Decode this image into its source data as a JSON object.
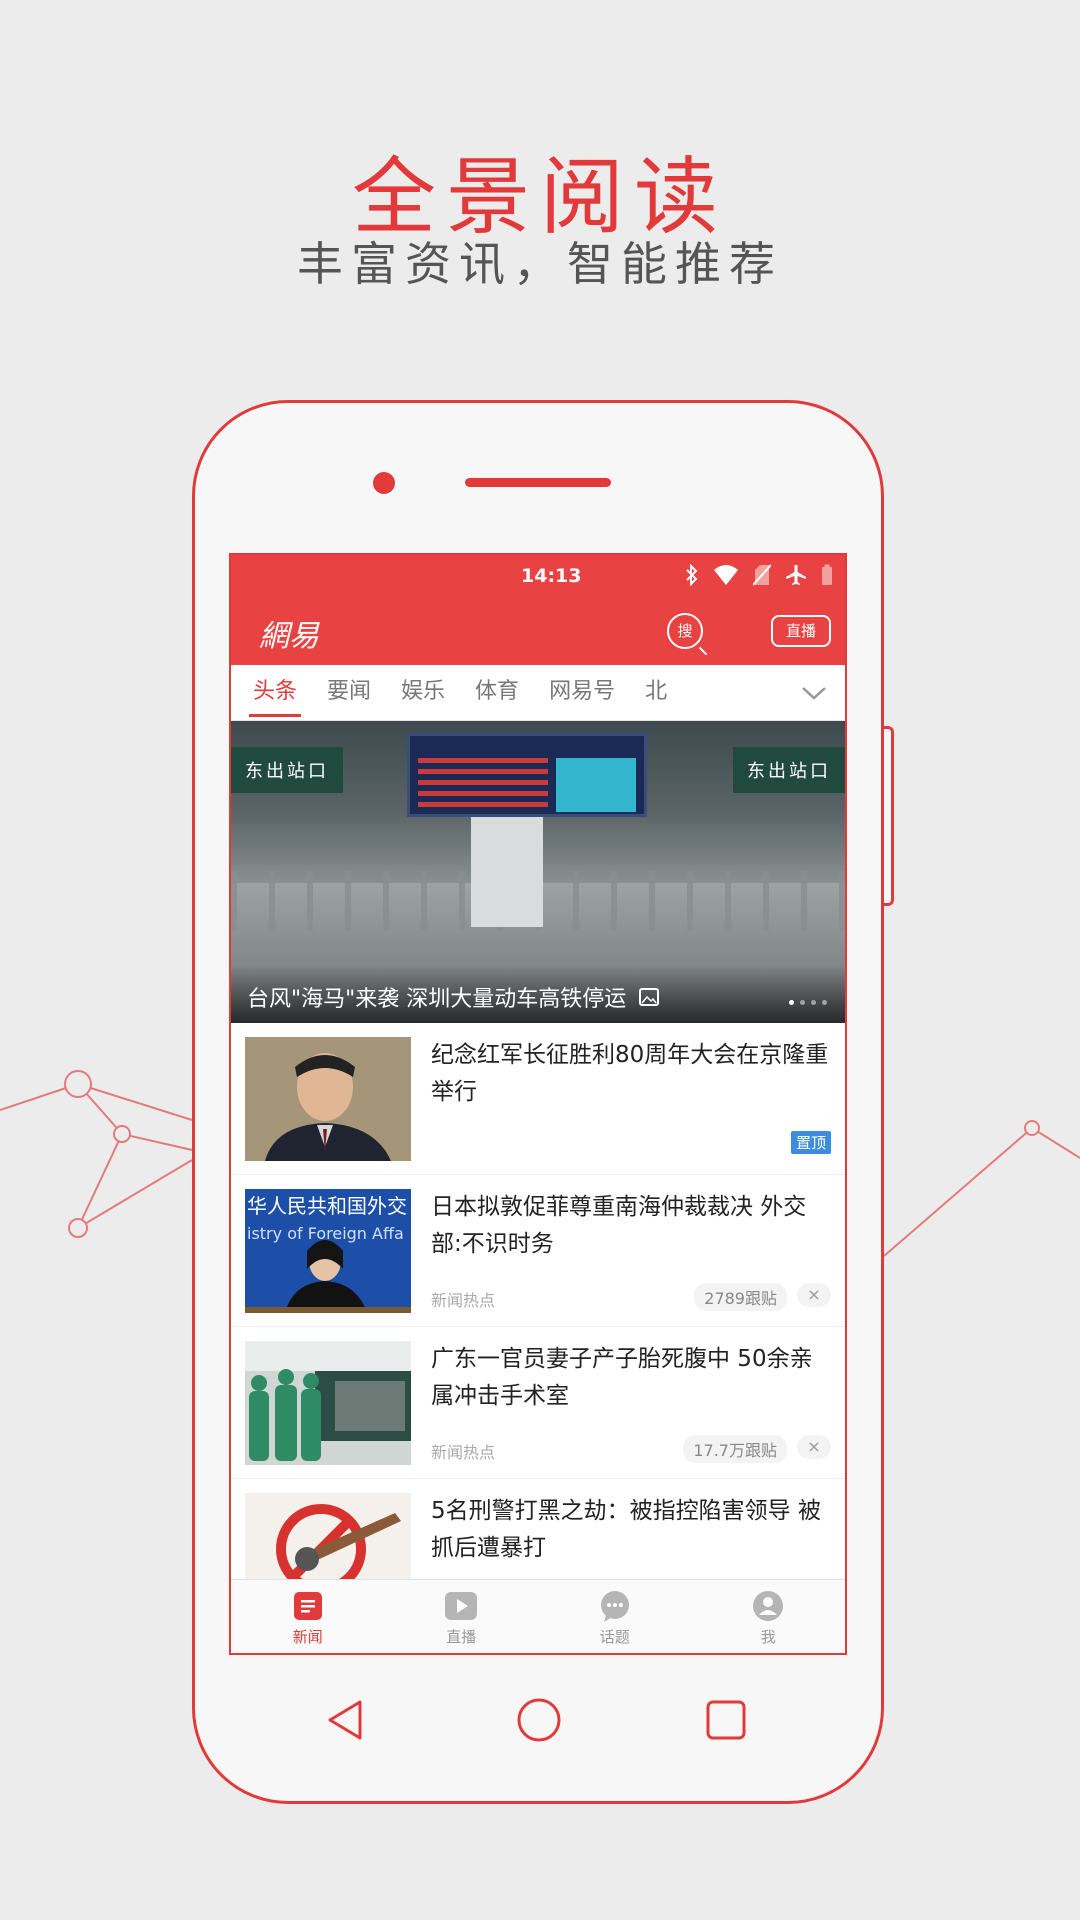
{
  "promo": {
    "title": "全景阅读",
    "subtitle": "丰富资讯，智能推荐"
  },
  "status_bar": {
    "time": "14:13",
    "icons": [
      "bluetooth-icon",
      "wifi-icon",
      "no-sim-icon",
      "airplane-icon",
      "battery-icon"
    ]
  },
  "app_bar": {
    "logo": "網易",
    "search_label": "搜",
    "live_label": "直播"
  },
  "tabs": [
    {
      "label": "头条",
      "active": true
    },
    {
      "label": "要闻"
    },
    {
      "label": "娱乐"
    },
    {
      "label": "体育"
    },
    {
      "label": "网易号"
    },
    {
      "label": "北"
    }
  ],
  "hero": {
    "caption": "台风\"海马\"来袭 深圳大量动车高铁停运",
    "sign_left": "东出站口",
    "sign_right": "东出站口",
    "page_count": 4,
    "current_page": 1
  },
  "news": [
    {
      "title": "纪念红军长征胜利80周年大会在京隆重举行",
      "badge": "置顶"
    },
    {
      "title": "日本拟敦促菲尊重南海仲裁裁决 外交部:不识时务",
      "source": "新闻热点",
      "count": "2789跟贴",
      "close": "×"
    },
    {
      "title": "广东一官员妻子产子胎死腹中 50余亲属冲击手术室",
      "source": "新闻热点",
      "count": "17.7万跟贴",
      "close": "×"
    },
    {
      "title": "5名刑警打黑之劫：被指控陷害领导 被抓后遭暴打"
    }
  ],
  "bottom_nav": [
    {
      "label": "新闻",
      "icon": "news-icon",
      "active": true
    },
    {
      "label": "直播",
      "icon": "play-icon"
    },
    {
      "label": "话题",
      "icon": "chat-bubble-icon"
    },
    {
      "label": "我",
      "icon": "user-icon"
    }
  ],
  "colors": {
    "brand_red": "#e84242",
    "accent_red": "#e23a3a",
    "pin_blue": "#3c8de0",
    "background": "#ececec"
  }
}
